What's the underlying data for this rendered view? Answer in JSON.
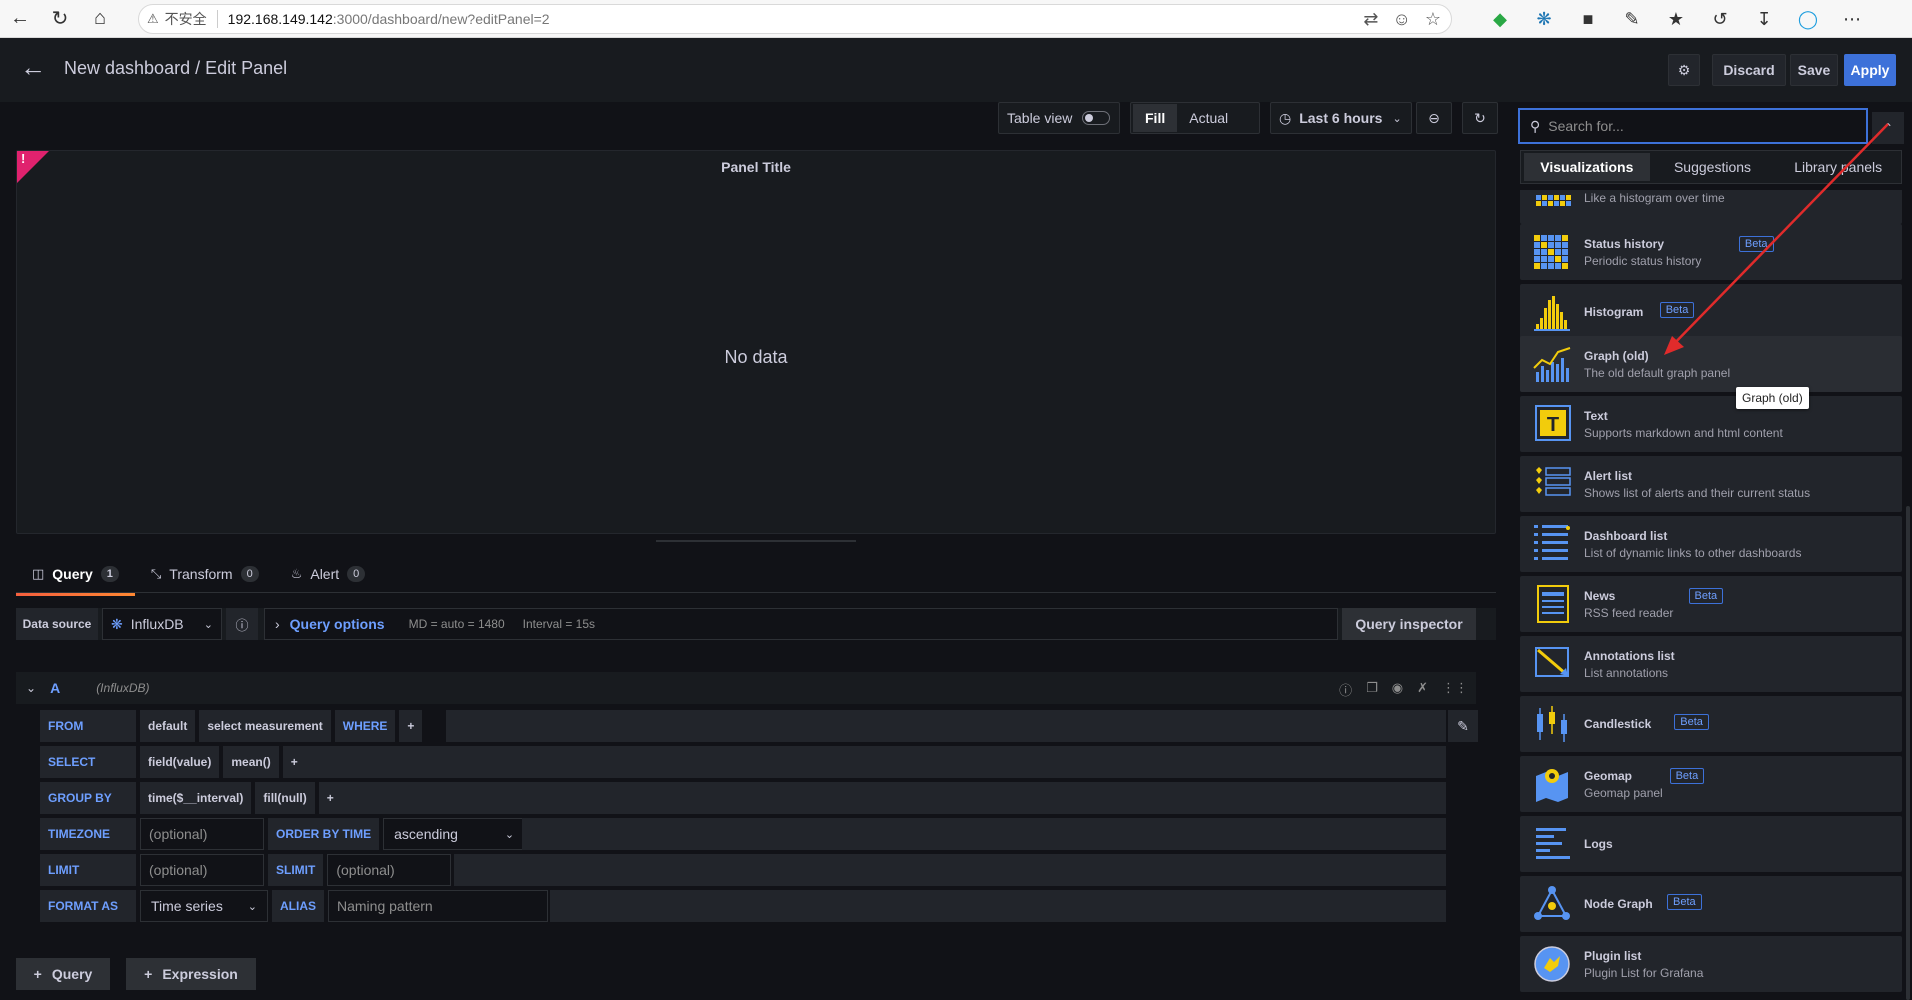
{
  "browser": {
    "insecure_label": "不安全",
    "url_host": "192.168.149.142",
    "url_path": ":3000/dashboard/new?editPanel=2"
  },
  "header": {
    "title": "New dashboard / Edit Panel",
    "discard": "Discard",
    "save": "Save",
    "apply": "Apply"
  },
  "panel_toolbar": {
    "table_view": "Table view",
    "fill": "Fill",
    "actual": "Actual",
    "time_range": "Last 6 hours"
  },
  "panel": {
    "title": "Panel Title",
    "no_data": "No data",
    "error_mark": "!"
  },
  "query_tabs": [
    {
      "label": "Query",
      "count": "1"
    },
    {
      "label": "Transform",
      "count": "0"
    },
    {
      "label": "Alert",
      "count": "0"
    }
  ],
  "datasource": {
    "label": "Data source",
    "name": "InfluxDB",
    "query_options": "Query options",
    "md": "MD = auto = 1480",
    "interval": "Interval = 15s",
    "inspector": "Query inspector"
  },
  "query": {
    "ref": "A",
    "ds": "(InfluxDB)",
    "from_kw": "FROM",
    "from_default": "default",
    "from_measurement": "select measurement",
    "where_kw": "WHERE",
    "select_kw": "SELECT",
    "select_field": "field(value)",
    "select_fn": "mean()",
    "groupby_kw": "GROUP BY",
    "groupby_time": "time($__interval)",
    "groupby_fill": "fill(null)",
    "plus": "+",
    "timezone_kw": "TIMEZONE",
    "optional": "(optional)",
    "orderby_kw": "ORDER BY TIME",
    "orderby_value": "ascending",
    "limit_kw": "LIMIT",
    "slimit_kw": "SLIMIT",
    "format_kw": "FORMAT AS",
    "format_value": "Time series",
    "alias_kw": "ALIAS",
    "alias_placeholder": "Naming pattern"
  },
  "footer": {
    "add_query": "Query",
    "add_expression": "Expression"
  },
  "viz_picker": {
    "search_placeholder": "Search for...",
    "tabs": [
      "Visualizations",
      "Suggestions",
      "Library panels"
    ],
    "tooltip": "Graph (old)",
    "beta": "Beta",
    "items": [
      {
        "name": "",
        "desc": "Like a histogram over time",
        "beta": false,
        "icon": "heatmap-icon"
      },
      {
        "name": "Status history",
        "desc": "Periodic status history",
        "beta": true,
        "icon": "status-history-icon"
      },
      {
        "name": "Histogram",
        "desc": "",
        "beta": true,
        "icon": "histogram-icon"
      },
      {
        "name": "Graph (old)",
        "desc": "The old default graph panel",
        "beta": false,
        "icon": "graph-icon"
      },
      {
        "name": "Text",
        "desc": "Supports markdown and html content",
        "beta": false,
        "icon": "text-icon"
      },
      {
        "name": "Alert list",
        "desc": "Shows list of alerts and their current status",
        "beta": false,
        "icon": "alert-list-icon"
      },
      {
        "name": "Dashboard list",
        "desc": "List of dynamic links to other dashboards",
        "beta": false,
        "icon": "dashboard-list-icon"
      },
      {
        "name": "News",
        "desc": "RSS feed reader",
        "beta": true,
        "icon": "news-icon"
      },
      {
        "name": "Annotations list",
        "desc": "List annotations",
        "beta": false,
        "icon": "annotations-list-icon"
      },
      {
        "name": "Candlestick",
        "desc": "",
        "beta": true,
        "icon": "candlestick-icon"
      },
      {
        "name": "Geomap",
        "desc": "Geomap panel",
        "beta": true,
        "icon": "geomap-icon"
      },
      {
        "name": "Logs",
        "desc": "",
        "beta": false,
        "icon": "logs-icon"
      },
      {
        "name": "Node Graph",
        "desc": "",
        "beta": true,
        "icon": "node-graph-icon"
      },
      {
        "name": "Plugin list",
        "desc": "Plugin List for Grafana",
        "beta": false,
        "icon": "plugin-list-icon"
      }
    ]
  },
  "colors": {
    "accent": "#3d71d9",
    "link": "#6e9fff",
    "error": "#e0226e",
    "arrow": "#e02b2b",
    "tab_underline": "#f55f3e"
  }
}
